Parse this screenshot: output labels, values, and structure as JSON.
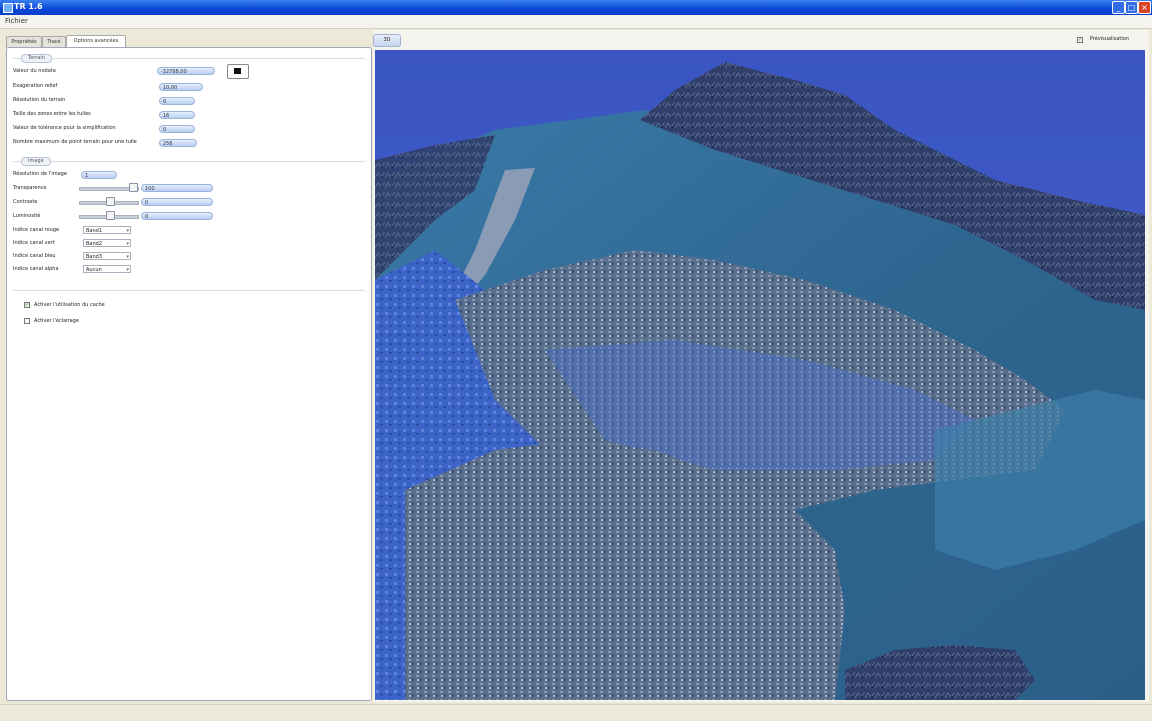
{
  "window": {
    "title": "TR 1.6"
  },
  "menu": {
    "file": "Fichier"
  },
  "tabs": [
    "Propriétés",
    "Tracé",
    "Options avancées"
  ],
  "terrain": {
    "section": "Terrain",
    "rows": [
      {
        "label": "Valeur du nodata",
        "value": "-32768,00"
      },
      {
        "label": "Exagération relief",
        "value": "10,00"
      },
      {
        "label": "Résolution du terrain",
        "value": "0"
      },
      {
        "label": "Taille des zones entre les tuiles",
        "value": "16"
      },
      {
        "label": "Valeur de tolérance pour la simplification",
        "value": "0"
      },
      {
        "label": "Nombre maximum de point terrain pour une tuile",
        "value": "256"
      }
    ]
  },
  "image": {
    "section": "Image",
    "resolution_label": "Résolution de l'image",
    "resolution_value": "1",
    "sliders": [
      {
        "label": "Transparence",
        "value": "100",
        "level": 0.95
      },
      {
        "label": "Contraste",
        "value": "0",
        "level": 0.5
      },
      {
        "label": "Luminosité",
        "value": "0",
        "level": 0.5
      }
    ],
    "channels": [
      {
        "label": "Indice canal rouge",
        "value": "Band1"
      },
      {
        "label": "Indice canal vert",
        "value": "Band2"
      },
      {
        "label": "Indice canal bleu",
        "value": "Band3"
      },
      {
        "label": "Indice canal alpha",
        "value": "Aucun"
      }
    ]
  },
  "options": [
    {
      "label": "Activer l'utilisation du cache",
      "checked": true
    },
    {
      "label": "Activer l'éclairage",
      "checked": false
    }
  ],
  "view": {
    "tab": "3D",
    "prerender_label": "Prévisualisation",
    "prerender_checked": true
  },
  "colors": {
    "titlebar": "#0a46d8",
    "sky": "#3d5bc6",
    "water": "#2f6d9a",
    "land": "#5b7090"
  }
}
